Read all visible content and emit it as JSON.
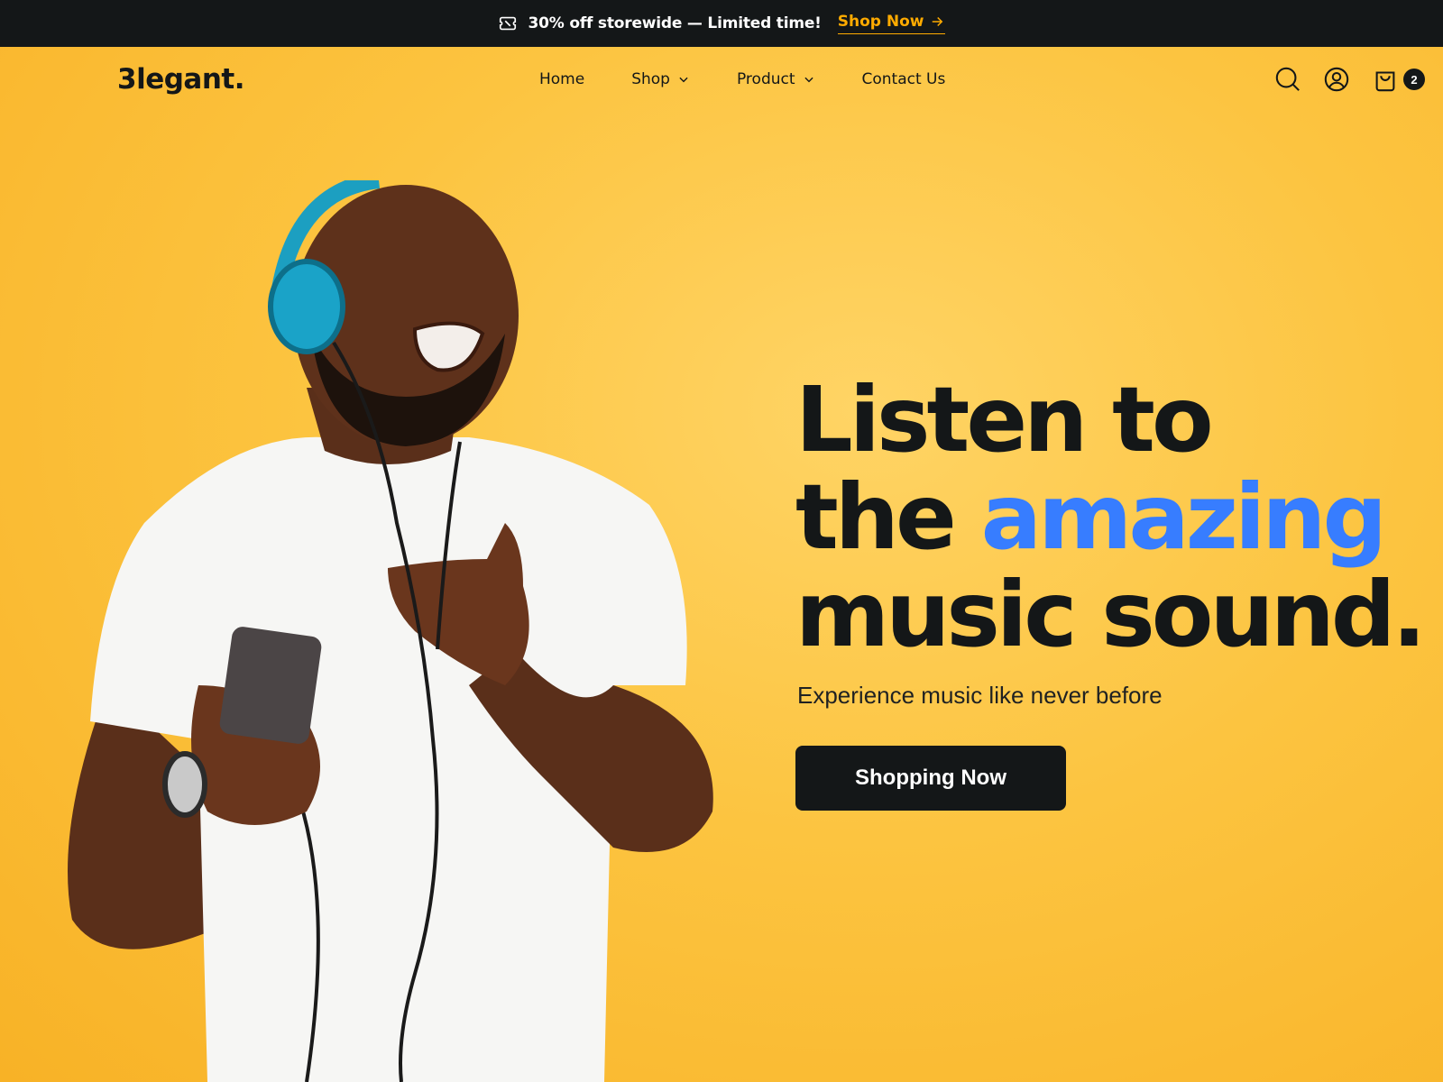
{
  "promo": {
    "message": "30% off storewide — Limited time!",
    "link_label": "Shop Now"
  },
  "nav": {
    "logo": "3legant.",
    "items": [
      {
        "label": "Home",
        "has_dropdown": false
      },
      {
        "label": "Shop",
        "has_dropdown": true
      },
      {
        "label": "Product",
        "has_dropdown": true
      },
      {
        "label": "Contact Us",
        "has_dropdown": false
      }
    ],
    "cart_count": "2",
    "icons": [
      "search-icon",
      "user-icon",
      "shopping-bag-icon"
    ]
  },
  "hero": {
    "headline_line1": "Listen to",
    "headline_line2_plain": "the ",
    "headline_line2_accent": "amazing",
    "headline_line3": "music sound.",
    "subtitle": "Experience music like never before",
    "cta_label": "Shopping Now"
  },
  "colors": {
    "background": "#fbbf3a",
    "dark": "#141718",
    "accent_blue": "#377dff",
    "promo_link": "#ffab00"
  }
}
